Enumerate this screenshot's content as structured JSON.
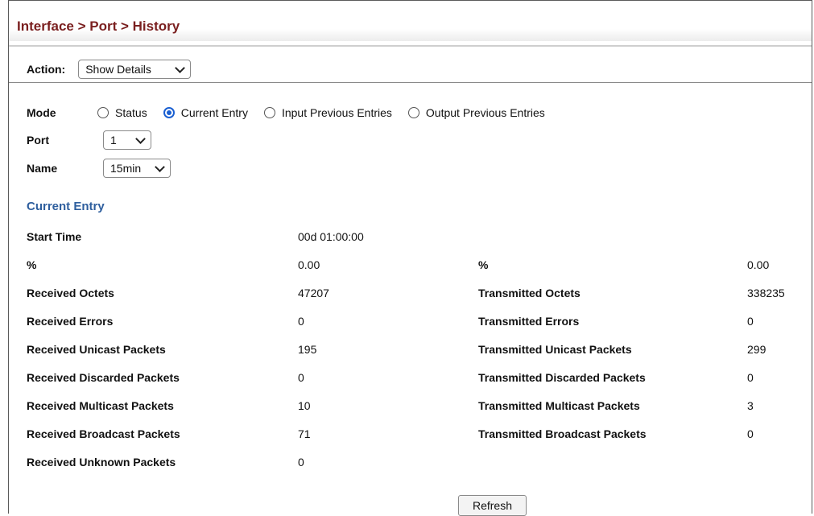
{
  "header": {
    "breadcrumb": "Interface > Port > History"
  },
  "action": {
    "label": "Action:",
    "selected": "Show Details"
  },
  "mode": {
    "label": "Mode",
    "options": [
      {
        "label": "Status",
        "checked": false
      },
      {
        "label": "Current Entry",
        "checked": true
      },
      {
        "label": "Input Previous Entries",
        "checked": false
      },
      {
        "label": "Output Previous Entries",
        "checked": false
      }
    ]
  },
  "port": {
    "label": "Port",
    "selected": "1"
  },
  "name": {
    "label": "Name",
    "selected": "15min"
  },
  "section": {
    "title": "Current Entry"
  },
  "stats": [
    {
      "l1": "Start Time",
      "v1": "00d 01:00:00",
      "l2": "",
      "v2": ""
    },
    {
      "l1": "%",
      "v1": "0.00",
      "l2": "%",
      "v2": "0.00"
    },
    {
      "l1": "Received Octets",
      "v1": "47207",
      "l2": "Transmitted Octets",
      "v2": "338235"
    },
    {
      "l1": "Received Errors",
      "v1": "0",
      "l2": "Transmitted Errors",
      "v2": "0"
    },
    {
      "l1": "Received Unicast Packets",
      "v1": "195",
      "l2": "Transmitted Unicast Packets",
      "v2": "299"
    },
    {
      "l1": "Received Discarded Packets",
      "v1": "0",
      "l2": "Transmitted Discarded Packets",
      "v2": "0"
    },
    {
      "l1": "Received Multicast Packets",
      "v1": "10",
      "l2": "Transmitted Multicast Packets",
      "v2": "3"
    },
    {
      "l1": "Received Broadcast Packets",
      "v1": "71",
      "l2": "Transmitted Broadcast Packets",
      "v2": "0"
    },
    {
      "l1": "Received Unknown Packets",
      "v1": "0",
      "l2": "",
      "v2": ""
    }
  ],
  "buttons": {
    "refresh": "Refresh"
  }
}
